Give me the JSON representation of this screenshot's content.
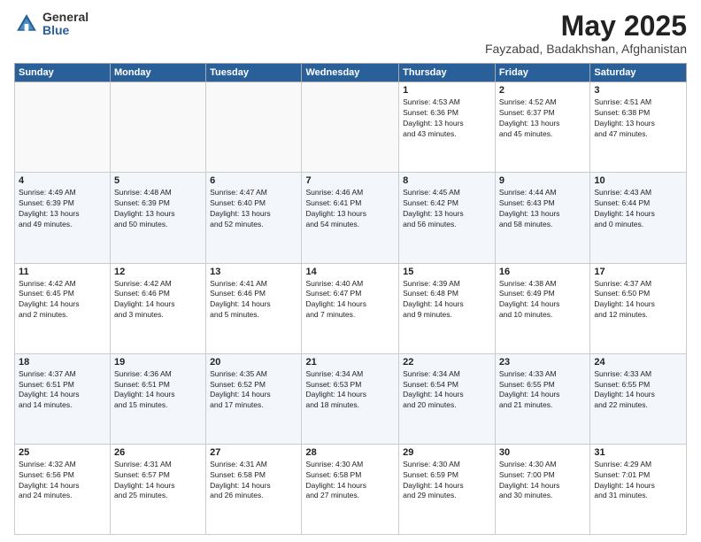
{
  "logo": {
    "general": "General",
    "blue": "Blue"
  },
  "header": {
    "month": "May 2025",
    "location": "Fayzabad, Badakhshan, Afghanistan"
  },
  "weekdays": [
    "Sunday",
    "Monday",
    "Tuesday",
    "Wednesday",
    "Thursday",
    "Friday",
    "Saturday"
  ],
  "weeks": [
    [
      {
        "day": "",
        "info": ""
      },
      {
        "day": "",
        "info": ""
      },
      {
        "day": "",
        "info": ""
      },
      {
        "day": "",
        "info": ""
      },
      {
        "day": "1",
        "info": "Sunrise: 4:53 AM\nSunset: 6:36 PM\nDaylight: 13 hours\nand 43 minutes."
      },
      {
        "day": "2",
        "info": "Sunrise: 4:52 AM\nSunset: 6:37 PM\nDaylight: 13 hours\nand 45 minutes."
      },
      {
        "day": "3",
        "info": "Sunrise: 4:51 AM\nSunset: 6:38 PM\nDaylight: 13 hours\nand 47 minutes."
      }
    ],
    [
      {
        "day": "4",
        "info": "Sunrise: 4:49 AM\nSunset: 6:39 PM\nDaylight: 13 hours\nand 49 minutes."
      },
      {
        "day": "5",
        "info": "Sunrise: 4:48 AM\nSunset: 6:39 PM\nDaylight: 13 hours\nand 50 minutes."
      },
      {
        "day": "6",
        "info": "Sunrise: 4:47 AM\nSunset: 6:40 PM\nDaylight: 13 hours\nand 52 minutes."
      },
      {
        "day": "7",
        "info": "Sunrise: 4:46 AM\nSunset: 6:41 PM\nDaylight: 13 hours\nand 54 minutes."
      },
      {
        "day": "8",
        "info": "Sunrise: 4:45 AM\nSunset: 6:42 PM\nDaylight: 13 hours\nand 56 minutes."
      },
      {
        "day": "9",
        "info": "Sunrise: 4:44 AM\nSunset: 6:43 PM\nDaylight: 13 hours\nand 58 minutes."
      },
      {
        "day": "10",
        "info": "Sunrise: 4:43 AM\nSunset: 6:44 PM\nDaylight: 14 hours\nand 0 minutes."
      }
    ],
    [
      {
        "day": "11",
        "info": "Sunrise: 4:42 AM\nSunset: 6:45 PM\nDaylight: 14 hours\nand 2 minutes."
      },
      {
        "day": "12",
        "info": "Sunrise: 4:42 AM\nSunset: 6:46 PM\nDaylight: 14 hours\nand 3 minutes."
      },
      {
        "day": "13",
        "info": "Sunrise: 4:41 AM\nSunset: 6:46 PM\nDaylight: 14 hours\nand 5 minutes."
      },
      {
        "day": "14",
        "info": "Sunrise: 4:40 AM\nSunset: 6:47 PM\nDaylight: 14 hours\nand 7 minutes."
      },
      {
        "day": "15",
        "info": "Sunrise: 4:39 AM\nSunset: 6:48 PM\nDaylight: 14 hours\nand 9 minutes."
      },
      {
        "day": "16",
        "info": "Sunrise: 4:38 AM\nSunset: 6:49 PM\nDaylight: 14 hours\nand 10 minutes."
      },
      {
        "day": "17",
        "info": "Sunrise: 4:37 AM\nSunset: 6:50 PM\nDaylight: 14 hours\nand 12 minutes."
      }
    ],
    [
      {
        "day": "18",
        "info": "Sunrise: 4:37 AM\nSunset: 6:51 PM\nDaylight: 14 hours\nand 14 minutes."
      },
      {
        "day": "19",
        "info": "Sunrise: 4:36 AM\nSunset: 6:51 PM\nDaylight: 14 hours\nand 15 minutes."
      },
      {
        "day": "20",
        "info": "Sunrise: 4:35 AM\nSunset: 6:52 PM\nDaylight: 14 hours\nand 17 minutes."
      },
      {
        "day": "21",
        "info": "Sunrise: 4:34 AM\nSunset: 6:53 PM\nDaylight: 14 hours\nand 18 minutes."
      },
      {
        "day": "22",
        "info": "Sunrise: 4:34 AM\nSunset: 6:54 PM\nDaylight: 14 hours\nand 20 minutes."
      },
      {
        "day": "23",
        "info": "Sunrise: 4:33 AM\nSunset: 6:55 PM\nDaylight: 14 hours\nand 21 minutes."
      },
      {
        "day": "24",
        "info": "Sunrise: 4:33 AM\nSunset: 6:55 PM\nDaylight: 14 hours\nand 22 minutes."
      }
    ],
    [
      {
        "day": "25",
        "info": "Sunrise: 4:32 AM\nSunset: 6:56 PM\nDaylight: 14 hours\nand 24 minutes."
      },
      {
        "day": "26",
        "info": "Sunrise: 4:31 AM\nSunset: 6:57 PM\nDaylight: 14 hours\nand 25 minutes."
      },
      {
        "day": "27",
        "info": "Sunrise: 4:31 AM\nSunset: 6:58 PM\nDaylight: 14 hours\nand 26 minutes."
      },
      {
        "day": "28",
        "info": "Sunrise: 4:30 AM\nSunset: 6:58 PM\nDaylight: 14 hours\nand 27 minutes."
      },
      {
        "day": "29",
        "info": "Sunrise: 4:30 AM\nSunset: 6:59 PM\nDaylight: 14 hours\nand 29 minutes."
      },
      {
        "day": "30",
        "info": "Sunrise: 4:30 AM\nSunset: 7:00 PM\nDaylight: 14 hours\nand 30 minutes."
      },
      {
        "day": "31",
        "info": "Sunrise: 4:29 AM\nSunset: 7:01 PM\nDaylight: 14 hours\nand 31 minutes."
      }
    ]
  ]
}
